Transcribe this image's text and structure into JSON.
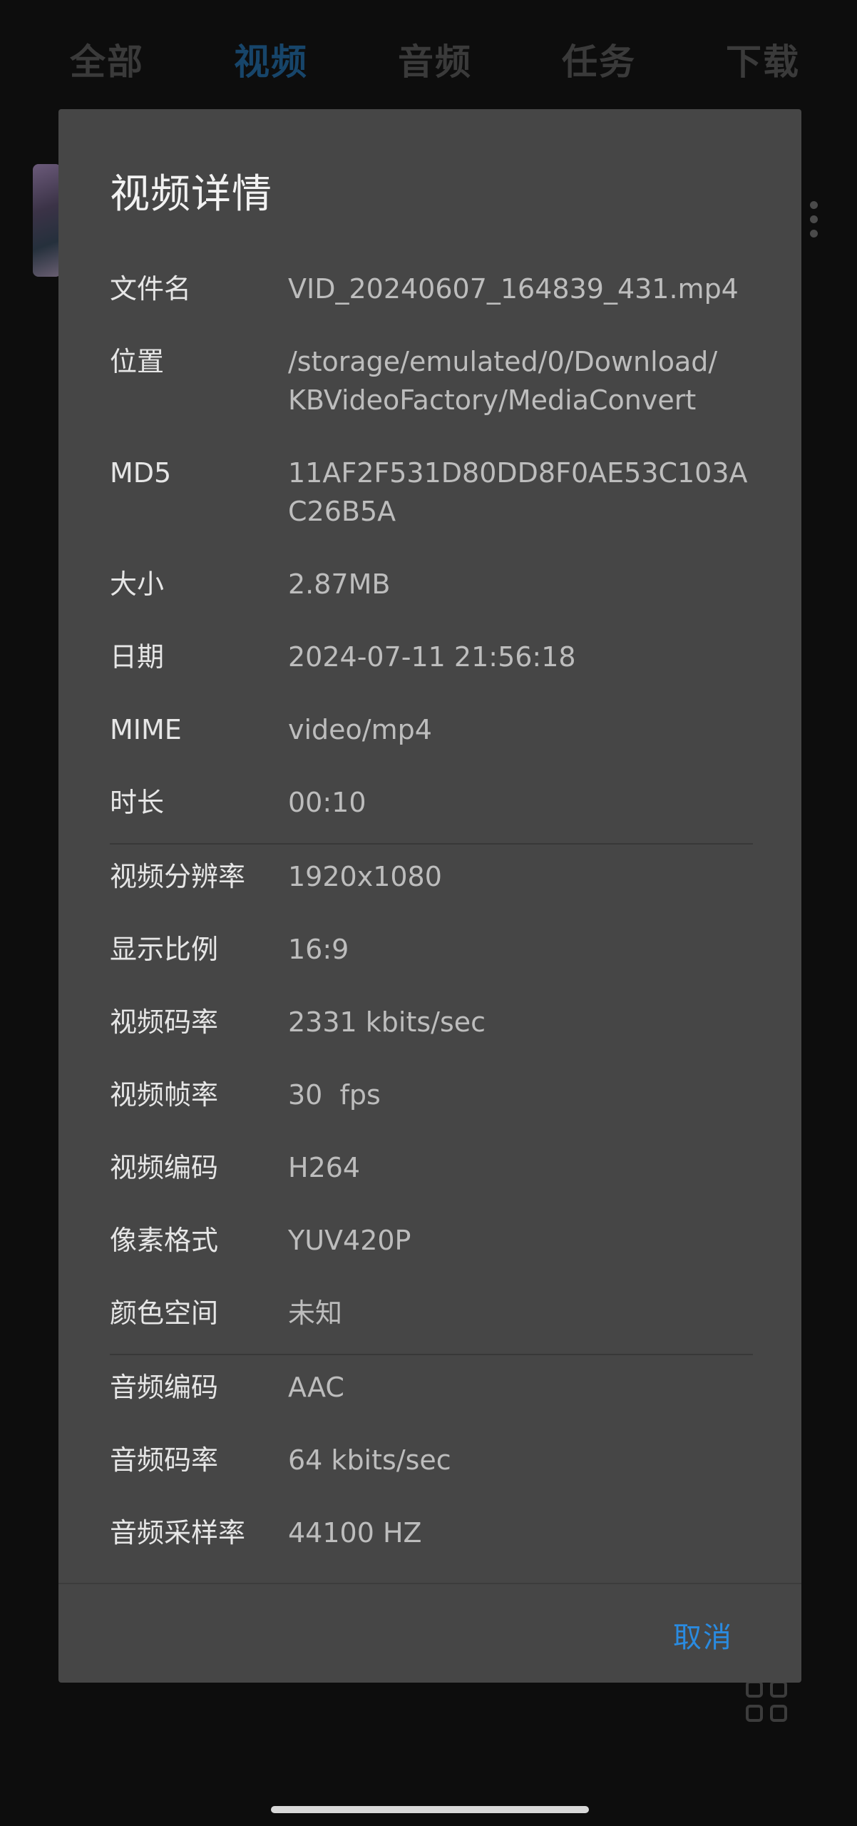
{
  "tabs": [
    "全部",
    "视频",
    "音频",
    "任务",
    "下载"
  ],
  "dialog": {
    "title": "视频详情",
    "cancel_label": "取消",
    "rows": [
      {
        "label": "文件名",
        "value": "VID_20240607_164839_431.mp4"
      },
      {
        "label": "位置",
        "value": "/storage/emulated/0/Download/\nKBVideoFactory/MediaConvert"
      },
      {
        "label": "MD5",
        "value": "11AF2F531D80DD8F0AE53C103A\nC26B5A"
      },
      {
        "label": "大小",
        "value": "2.87MB"
      },
      {
        "label": "日期",
        "value": "2024-07-11 21:56:18"
      },
      {
        "label": "MIME",
        "value": "video/mp4"
      },
      {
        "label": "时长",
        "value": "00:10"
      },
      {
        "label": "视频分辨率",
        "value": "1920x1080"
      },
      {
        "label": "显示比例",
        "value": "16:9"
      },
      {
        "label": "视频码率",
        "value": "2331 kbits/sec"
      },
      {
        "label": "视频帧率",
        "value": "30  fps"
      },
      {
        "label": "视频编码",
        "value": "H264"
      },
      {
        "label": "像素格式",
        "value": "YUV420P"
      },
      {
        "label": "颜色空间",
        "value": "未知"
      },
      {
        "label": "音频编码",
        "value": "AAC"
      },
      {
        "label": "音频码率",
        "value": "64 kbits/sec"
      },
      {
        "label": "音频采样率",
        "value": "44100 HZ"
      }
    ]
  },
  "icons": {
    "more": "more-vertical-icon",
    "grid": "grid-view-icon"
  },
  "colors": {
    "accent": "#2a8be0",
    "active_tab": "#17456a",
    "dialog_bg": "#464646"
  }
}
